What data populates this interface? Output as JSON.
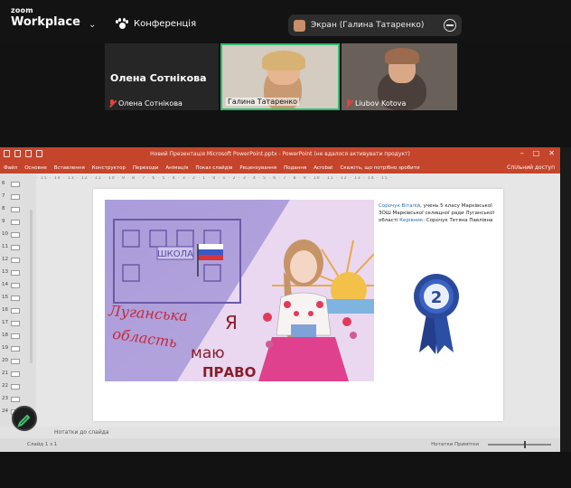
{
  "brand": {
    "line1": "zoom",
    "line2": "Workplace"
  },
  "menu": {
    "conference_label": "Конференція"
  },
  "share": {
    "label": "Экран (Галина Татаренко)"
  },
  "participants": {
    "main_name": "Олена Сотнікова",
    "tile1_name": "Олена Сотнікова",
    "tile2_name": "Галина Татаренко",
    "tile3_name": "Liubov Kotova"
  },
  "ppt": {
    "title": "Новий Презентація Microsoft PowerPoint.pptx - PowerPoint (не вдалося активувати продукт)",
    "tabs": [
      "Файл",
      "Основне",
      "Вставлення",
      "Конструктор",
      "Переходи",
      "Анімація",
      "Показ слайдів",
      "Рецензування",
      "Подання",
      "Acrobat",
      "Скажіть, що потрібно зробити"
    ],
    "share_button": "Спільний доступ",
    "ruler": "· 15 · 14 · 13 · 12 · 11 · 10 · 9 · 8 · 7 · 6 · 5 · 4 · 3 · 2 · 1 · 0 · 1 · 2 · 3 · 4 · 5 · 6 · 7 · 8 · 9 · 10 · 11 · 12 · 13 · 14 · 15 ·",
    "slide_numbers": [
      "6",
      "7",
      "8",
      "9",
      "10",
      "11",
      "12",
      "13",
      "14",
      "15",
      "16",
      "17",
      "18",
      "19",
      "20",
      "21",
      "22",
      "23",
      "24"
    ],
    "notes_placeholder": "Нотатки до слайда",
    "status_left": "Слайд 1 з 1",
    "status_right": "Нотатки   Примітки"
  },
  "slide": {
    "caption_name": "Сорочук Віталій",
    "caption_body": ", учень 5 класу Марківської ЗОШ Марківської селищної ради Луганської області",
    "caption_teacher_label": "Керівник",
    "caption_teacher": ": Сорочук Тетяна Павлівна",
    "drawing_school": "ШКОЛА",
    "drawing_region_1": "Луганська",
    "drawing_region_2": "область",
    "drawing_slogan_1": "Я",
    "drawing_slogan_2": "маю",
    "drawing_slogan_3": "ПРАВО",
    "badge_number": "2"
  },
  "colors": {
    "ppt_red": "#c4452b",
    "active_speaker": "#2dbd6e",
    "zoom_bg": "#131313"
  }
}
